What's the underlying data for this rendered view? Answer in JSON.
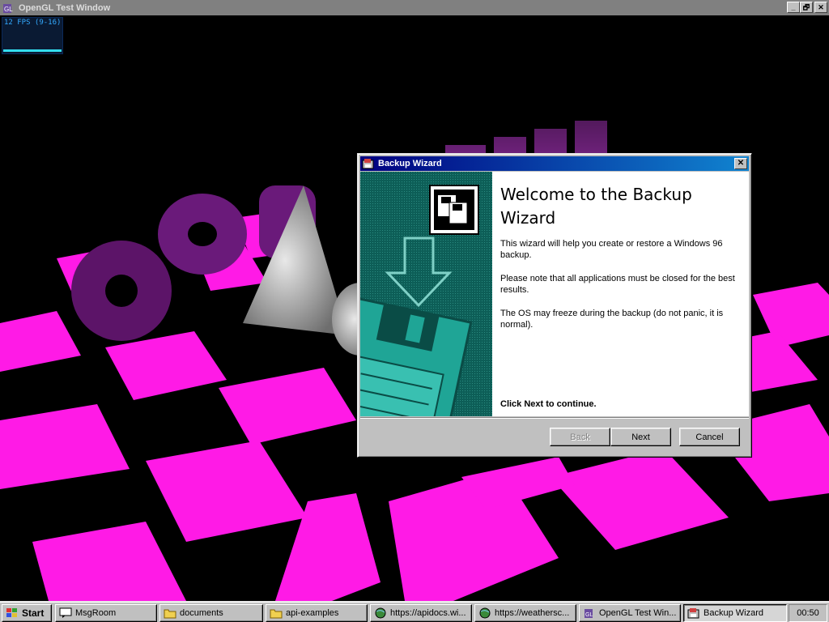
{
  "gl_window": {
    "title": "OpenGL Test Window",
    "fps_text": "12 FPS (9-16)",
    "buttons": {
      "minimize": "_",
      "maximize": "🗗",
      "close": "✕"
    }
  },
  "wizard": {
    "title": "Backup Wizard",
    "heading": "Welcome to the Backup Wizard",
    "paragraphs": [
      "This wizard will help you create or restore a Windows 96 backup.",
      "Please note that all applications must be closed for the best results.",
      "The OS may freeze during the backup (do not panic, it is normal)."
    ],
    "continue_text": "Click Next to continue.",
    "buttons": {
      "back": "Back",
      "next": "Next",
      "cancel": "Cancel"
    },
    "close_glyph": "✕"
  },
  "taskbar": {
    "start_label": "Start",
    "tasks": [
      {
        "label": "MsgRoom",
        "icon": "chat-icon"
      },
      {
        "label": "documents",
        "icon": "folder-icon"
      },
      {
        "label": "api-examples",
        "icon": "folder-icon"
      },
      {
        "label": "https://apidocs.wi...",
        "icon": "globe-icon"
      },
      {
        "label": "https://weathersc...",
        "icon": "globe-icon"
      },
      {
        "label": "OpenGL Test Win...",
        "icon": "opengl-icon"
      },
      {
        "label": "Backup Wizard",
        "icon": "backup-icon",
        "active": true
      }
    ],
    "clock": "00:50"
  },
  "colors": {
    "floor_magenta": "#ff1ae6",
    "title_blue": "#000080",
    "wizard_teal": "#0f6b63"
  }
}
